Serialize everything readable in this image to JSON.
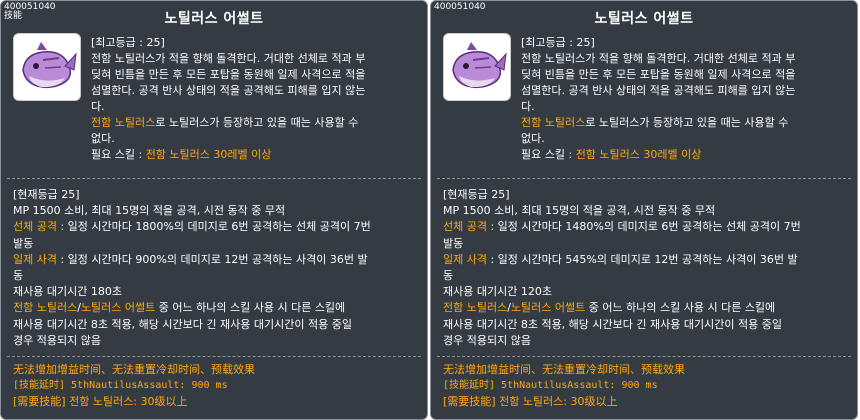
{
  "panels": [
    {
      "skill_id": "400051040",
      "skill_id_sub": "技能",
      "title": "노틸러스 어썰트",
      "icon": "nautilus-whale-icon",
      "max_level": "[최고등급 : 25]",
      "desc_lines": [
        "전함 노틸러스가 적을 향해 돌격한다. 거대한 선체로 적과 부",
        "딪혀 빈틈을 만든 후 모든 포탑을 동원해 일제 사격으로 적을",
        "섬멸한다. 공격 반사 상태의 적을 공격해도 피해를 입지 않는",
        "다."
      ],
      "cond_highlight": "전함 노틸러스",
      "cond_rest_1": "로 노틸러스가 등장하고 있을 때는 사용할 수",
      "cond_rest_2": "없다.",
      "req_label": "필요 스킬 : ",
      "req_value": "전함 노틸러스 30레벨 이상",
      "cur_level": "[현재등급 25]",
      "cur_line1": "MP 1500 소비, 최대 15명의 적을 공격, 시전 동작 중 무적",
      "hull_label": "선체 공격",
      "hull_rest": " : 일정 시간마다 1800%의 데미지로 6번 공격하는 선체 공격이 7번",
      "hull_rest_2": "발동",
      "salvo_label": "일제 사격",
      "salvo_rest": " : 일정 시간마다 900%의 데미지로 12번 공격하는 사격이 36번 발",
      "salvo_rest_2": "동",
      "cooldown": "재사용 대기시간 180초",
      "share_a": "전함 노틸러스",
      "share_sep": "/",
      "share_b": "노틸러스 어썰트",
      "share_rest": " 중 어느 하나의 스킬 사용 시 다른 스킬에",
      "share_line2": "재사용 대기시간 8초 적용, 해당 시간보다 긴 재사용 대기시간이 적용 중일",
      "share_line3": "경우 적용되지 않음",
      "foot1": "无法增加增益时间、无法重置冷却时间、预载效果",
      "foot2": "[技能延时] 5thNautilusAssault: 900 ms",
      "foot3": "[需要技能] 전함 노틸러스: 30级以上"
    },
    {
      "skill_id": "400051040",
      "title": "노틸러스 어썰트",
      "icon": "nautilus-whale-icon",
      "max_level": "[최고등급 : 25]",
      "desc_lines": [
        "전함 노틸러스가 적을 향해 돌격한다. 거대한 선체로 적과 부",
        "딪혀 빈틈을 만든 후 모든 포탑을 동원해 일제 사격으로 적을",
        "섬멸한다. 공격 반사 상태의 적을 공격해도 피해를 입지 않는",
        "다."
      ],
      "cond_highlight": "전함 노틸러스",
      "cond_rest_1": "로 노틸러스가 등장하고 있을 때는 사용할 수",
      "cond_rest_2": "없다.",
      "req_label": "필요 스킬 : ",
      "req_value": "전함 노틸러스 30레벨 이상",
      "cur_level": "[현재등급 25]",
      "cur_line1": "MP 1500 소비, 최대 15명의 적을 공격, 시전 동작 중 무적",
      "hull_label": "선체 공격",
      "hull_rest": " : 일정 시간마다 1480%의 데미지로 6번 공격하는 선체 공격이 7번",
      "hull_rest_2": "발동",
      "salvo_label": "일제 사격",
      "salvo_rest": " : 일정 시간마다 545%의 데미지로 12번 공격하는 사격이 36번 발",
      "salvo_rest_2": "동",
      "cooldown": "재사용 대기시간 120초",
      "share_a": "전함 노틸러스",
      "share_sep": "/",
      "share_b": "노틸러스 어썰트",
      "share_rest": " 중 어느 하나의 스킬 사용 시 다른 스킬에",
      "share_line2": "재사용 대기시간 8초 적용, 해당 시간보다 긴 재사용 대기시간이 적용 중일",
      "share_line3": "경우 적용되지 않음",
      "foot1": "无法增加增益时间、无法重置冷却时间、预载效果",
      "foot2": "[技能延时] 5thNautilusAssault: 900 ms",
      "foot3": "[需要技能] 전함 노틸러스: 30级以上"
    }
  ],
  "colors": {
    "panel_bg": "#343b43",
    "highlight": "#ffa812",
    "text": "#ffffff"
  }
}
